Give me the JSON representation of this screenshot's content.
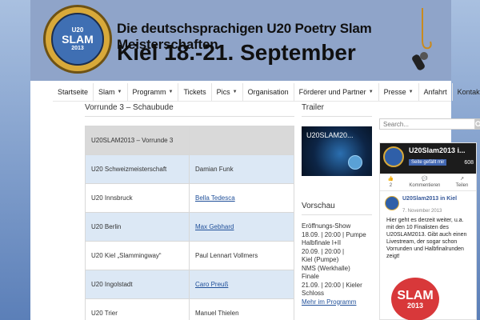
{
  "banner": {
    "logo_top": "U20",
    "logo_main": "SLAM",
    "logo_bottom": "2013",
    "headline": "Die deutschsprachigen U20 Poetry Slam Meisterschaften",
    "dates": "Kiel 18.-21. September"
  },
  "nav": {
    "items": [
      {
        "label": "Startseite",
        "dropdown": false
      },
      {
        "label": "Slam",
        "dropdown": true
      },
      {
        "label": "Programm",
        "dropdown": true
      },
      {
        "label": "Tickets",
        "dropdown": false
      },
      {
        "label": "Pics",
        "dropdown": true
      },
      {
        "label": "Organisation",
        "dropdown": false
      },
      {
        "label": "Förderer und Partner",
        "dropdown": true
      },
      {
        "label": "Presse",
        "dropdown": true
      },
      {
        "label": "Anfahrt",
        "dropdown": false
      },
      {
        "label": "Kontakt",
        "dropdown": false
      }
    ]
  },
  "main": {
    "title": "Vorrunde 3 – Schaubude",
    "table_header": "U20SLAM2013 – Vorrunde 3",
    "rows": [
      {
        "group": "U20 Schweizmeisterschaft",
        "name": "Damian Funk",
        "link": false
      },
      {
        "group": "U20 Innsbruck",
        "name": "Bella Tedesca",
        "link": true
      },
      {
        "group": "U20 Berlin",
        "name": "Max Gebhard",
        "link": true
      },
      {
        "group": "U20 Kiel „Slammingway“",
        "name": "Paul Lennart Vollmers",
        "link": false
      },
      {
        "group": "U20 Ingolstadt",
        "name": "Caro Preuß",
        "link": true
      },
      {
        "group": "U20 Trier",
        "name": "Manuel Thielen",
        "link": false
      }
    ]
  },
  "trailer": {
    "title": "Trailer",
    "video_title": "U20SLAM20..."
  },
  "vorschau": {
    "title": "Vorschau",
    "lines": [
      "Eröffnungs-Show",
      "18.09. | 20:00 | Pumpe",
      "Halbfinale I+II",
      "20.09. | 20:00 |",
      "Kiel (Pumpe)",
      "NMS (Werkhalle)",
      "Finale",
      "21.09. | 20:00 | Kieler",
      "Schloss"
    ],
    "more_link": "Mehr im Programm"
  },
  "search": {
    "placeholder": "Search..."
  },
  "facebook": {
    "page_name": "U20Slam2013 i...",
    "like_label": "Seite gefällt mir",
    "like_count": "608",
    "stats": [
      {
        "top": "2",
        "bottom": ""
      },
      {
        "top": "",
        "bottom": "Kommentieren"
      },
      {
        "top": "",
        "bottom": "Teilen"
      }
    ],
    "post_author": "U20Slam2013 in Kiel",
    "post_date": "7. November 2013",
    "post_text": "Hier geht es derzeit weiter, u.a. mit den 10 Finalisten des U20SLAM2013. Gibt auch einen Livestream, der sogar schon Vorrunden und Halbfinalrunden zeigt!",
    "image_text_1": "SLAM",
    "image_text_2": "2013"
  },
  "colors": {
    "background_top": "#a9c0e0",
    "background_bottom": "#5b7fb8",
    "link": "#1f4f99",
    "table_alt_row": "#dce8f5",
    "facebook_blue": "#4267b2"
  }
}
